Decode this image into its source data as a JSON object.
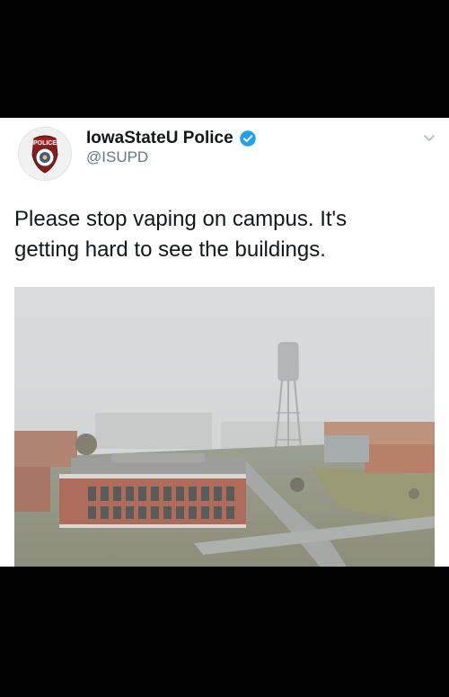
{
  "tweet": {
    "display_name": "IowaStateU Police",
    "handle": "@ISUPD",
    "avatar_badge_text": "POLICE",
    "text_line1": "Please stop vaping on campus.  It's",
    "text_line2": "getting hard to see the buildings."
  },
  "icons": {
    "verified": "verified-badge-icon",
    "menu": "chevron-down-icon"
  },
  "colors": {
    "verified_blue": "#1DA1F2",
    "text": "#14171A",
    "muted": "#657786",
    "fog": "#D3D6D6"
  }
}
